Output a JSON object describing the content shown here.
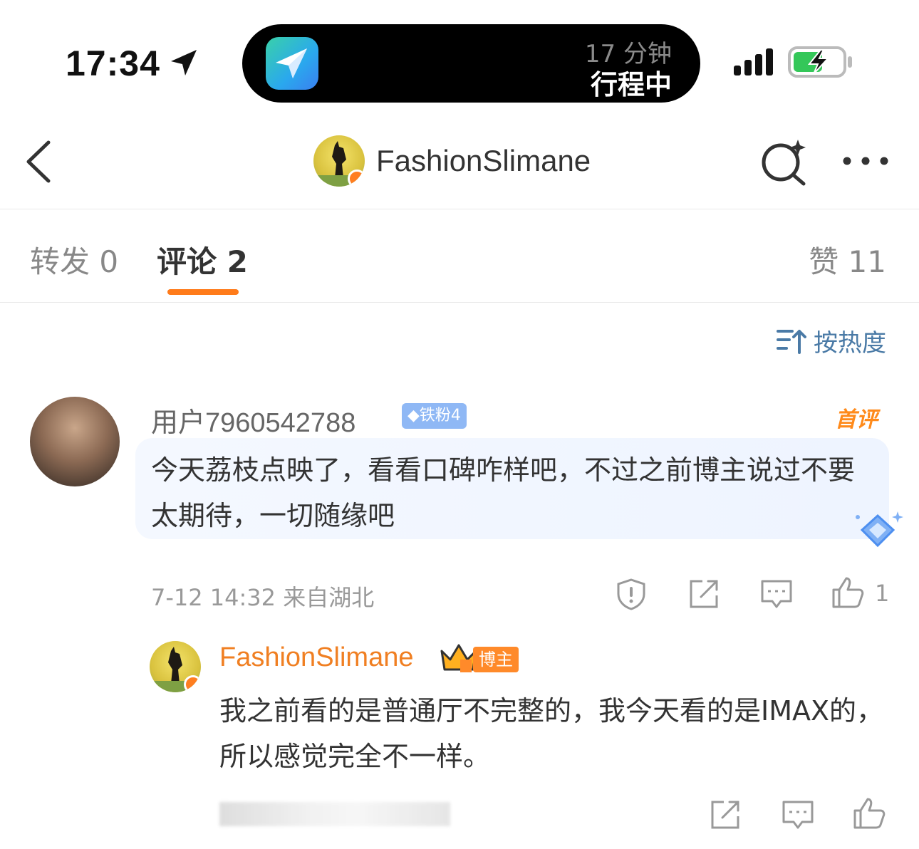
{
  "status_bar": {
    "time": "17:34",
    "island_line1": "17 分钟",
    "island_line2": "行程中"
  },
  "header": {
    "title": "FashionSlimane"
  },
  "tabs": {
    "repost": "转发 0",
    "comment": "评论 2",
    "like": "赞 11"
  },
  "sort": {
    "label": "按热度"
  },
  "comment": {
    "username": "用户7960542788",
    "fan_badge": "◆铁粉4",
    "first_badge": "首评",
    "text": "今天荔枝点映了，看看口碑咋样吧，不过之前博主说过不要太期待，一切随缘吧",
    "meta": "7-12 14:32  来自湖北",
    "like_count": "1"
  },
  "reply": {
    "username": "FashionSlimane",
    "host_badge": "博主",
    "text": "我之前看的是普通厅不完整的，我今天看的是IMAX的，所以感觉完全不一样。"
  },
  "colors": {
    "accent_orange": "#ff7b1a",
    "link_blue": "#4a7aa6",
    "fan_badge": "#8fb8f5"
  }
}
